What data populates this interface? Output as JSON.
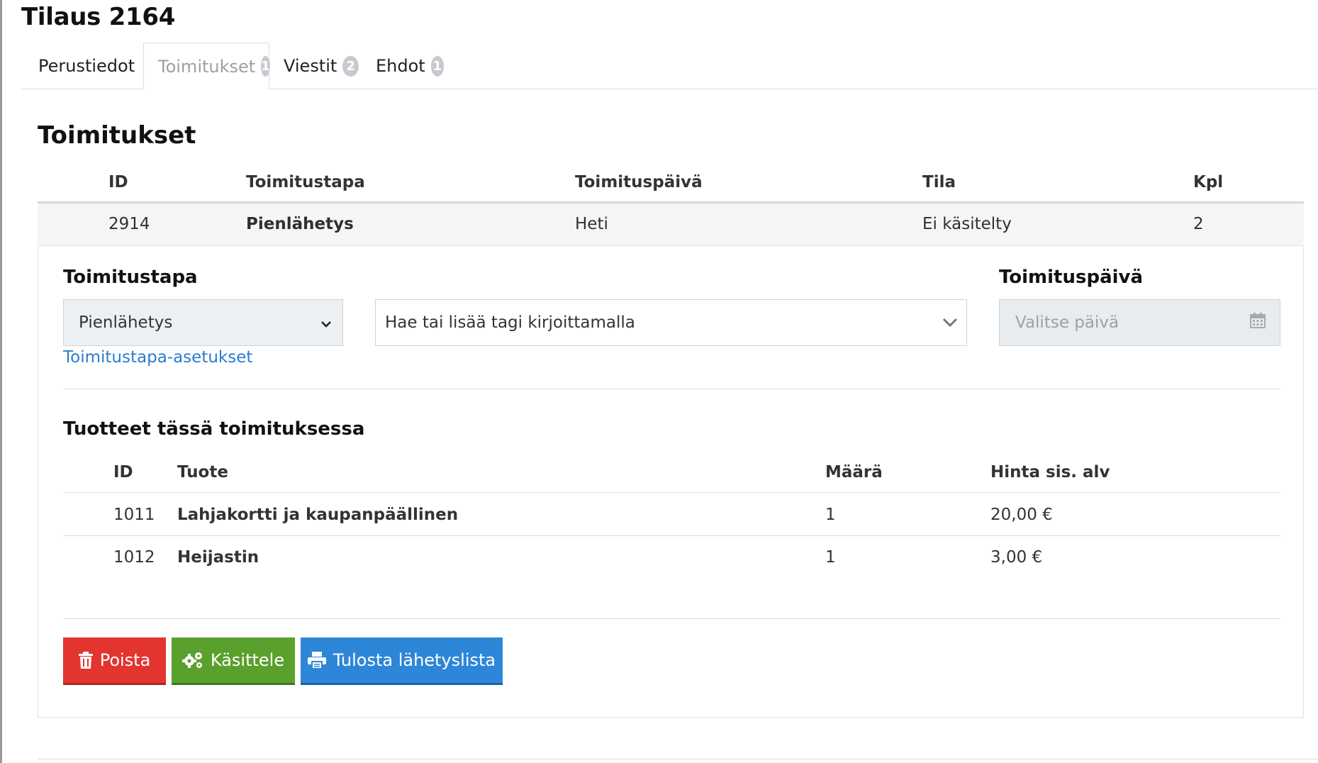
{
  "page": {
    "title": "Tilaus 2164"
  },
  "tabs": [
    {
      "label": "Perustiedot",
      "badge": ""
    },
    {
      "label": "Toimitukset",
      "badge": "1"
    },
    {
      "label": "Viestit",
      "badge": "2"
    },
    {
      "label": "Ehdot",
      "badge": "1"
    }
  ],
  "section": {
    "title": "Toimitukset"
  },
  "deliveries": {
    "columns": [
      "ID",
      "Toimitustapa",
      "Toimituspäivä",
      "Tila",
      "Kpl"
    ],
    "rows": [
      {
        "id": "2914",
        "method": "Pienlähetys",
        "date": "Heti",
        "status": "Ei käsitelty",
        "qty": "2"
      }
    ]
  },
  "detail": {
    "method_label": "Toimitustapa",
    "method_value": "Pienlähetys",
    "tag_placeholder": "Hae tai lisää tagi kirjoittamalla",
    "method_settings_link": "Toimitustapa-asetukset",
    "date_label": "Toimituspäivä",
    "date_placeholder": "Valitse päivä",
    "products_title": "Tuotteet tässä toimituksessa",
    "products_columns": [
      "ID",
      "Tuote",
      "Määrä",
      "Hinta sis. alv"
    ],
    "products": [
      {
        "id": "1011",
        "name": "Lahjakortti ja kaupanpäällinen",
        "qty": "1",
        "price": "20,00 €"
      },
      {
        "id": "1012",
        "name": "Heijastin",
        "qty": "1",
        "price": "3,00 €"
      }
    ]
  },
  "buttons": {
    "delete": "Poista",
    "process": "Käsittele",
    "print": "Tulosta lähetyslista"
  },
  "colors": {
    "delete": "#e3342f",
    "process": "#5aa02c",
    "print": "#2e86d9",
    "link": "#2b7bd1"
  },
  "icons": {
    "delete": "trash-icon",
    "process": "gears-icon",
    "print": "print-icon",
    "select": "chevron-down-icon",
    "date": "calendar-icon"
  }
}
